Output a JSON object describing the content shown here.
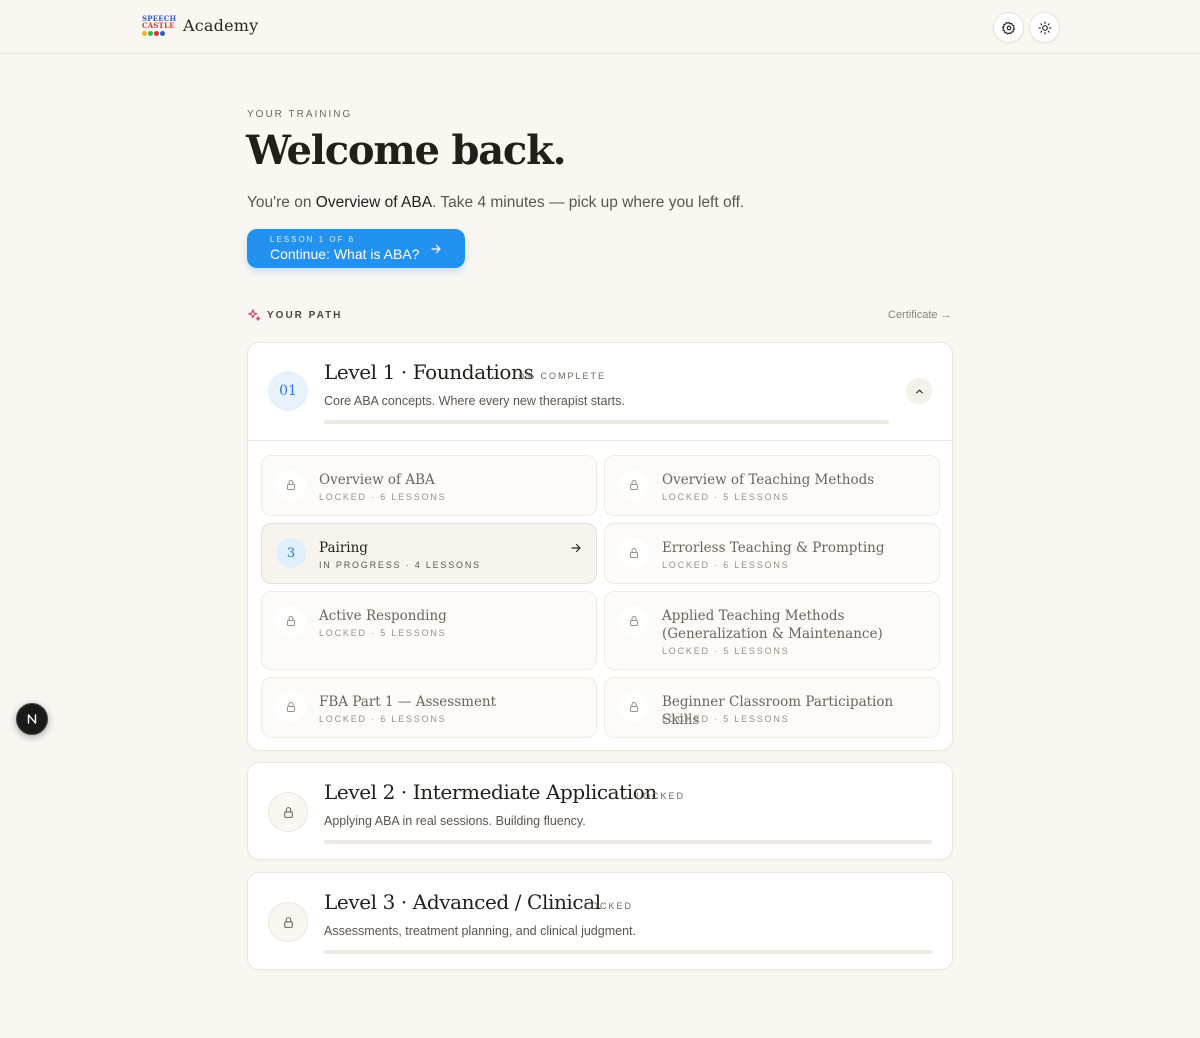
{
  "header": {
    "logo_line1": "SPEECH",
    "logo_line2": "CASTLE",
    "brand": "Academy"
  },
  "hero": {
    "eyebrow": "YOUR TRAINING",
    "title": "Welcome back.",
    "sub_prefix": "You're on ",
    "sub_course": "Overview of ABA",
    "sub_suffix": ". Take 4 minutes — pick up where you left off.",
    "cta_kicker": "LESSON 1 OF 6",
    "cta_label": "Continue: What is ABA?"
  },
  "path": {
    "label": "YOUR PATH",
    "certificate_link": "Certificate →"
  },
  "levels": [
    {
      "badge": "01",
      "title": "Level 1 · Foundations",
      "tag": "0% COMPLETE",
      "desc": "Core ABA concepts. Where every new therapist starts.",
      "progress": 0,
      "modules": [
        {
          "name": "Overview of ABA",
          "meta": "LOCKED · 6 LESSONS"
        },
        {
          "name": "Overview of Teaching Methods",
          "meta": "LOCKED · 5 LESSONS"
        },
        {
          "badge": "3",
          "name": "Pairing",
          "meta": "IN PROGRESS · 4 LESSONS"
        },
        {
          "name": "Errorless Teaching & Prompting",
          "meta": "LOCKED · 6 LESSONS"
        },
        {
          "name": "Active Responding",
          "meta": "LOCKED · 5 LESSONS"
        },
        {
          "name": "Applied Teaching Methods (Generalization & Maintenance)",
          "meta": "LOCKED · 5 LESSONS"
        },
        {
          "name": "FBA Part 1 — Assessment",
          "meta": "LOCKED · 6 LESSONS"
        },
        {
          "name": "Beginner Classroom Participation Skills",
          "meta": "LOCKED · 5 LESSONS"
        }
      ]
    },
    {
      "title": "Level 2 · Intermediate Application",
      "tag": "LOCKED",
      "desc": "Applying ABA in real sessions. Building fluency.",
      "progress": 0
    },
    {
      "title": "Level 3 · Advanced / Clinical",
      "tag": "LOCKED",
      "desc": "Assessments, treatment planning, and clinical judgment.",
      "progress": 0
    }
  ],
  "floating": {
    "label": "N"
  },
  "colors": {
    "accent": "#2291f0",
    "background": "#faf7f2",
    "path_icon": "#e0457b"
  },
  "icons": [
    "settings-icon",
    "theme-toggle-icon",
    "arrow-right-icon",
    "sparkle-icon",
    "lock-icon",
    "chevron-up-icon"
  ]
}
